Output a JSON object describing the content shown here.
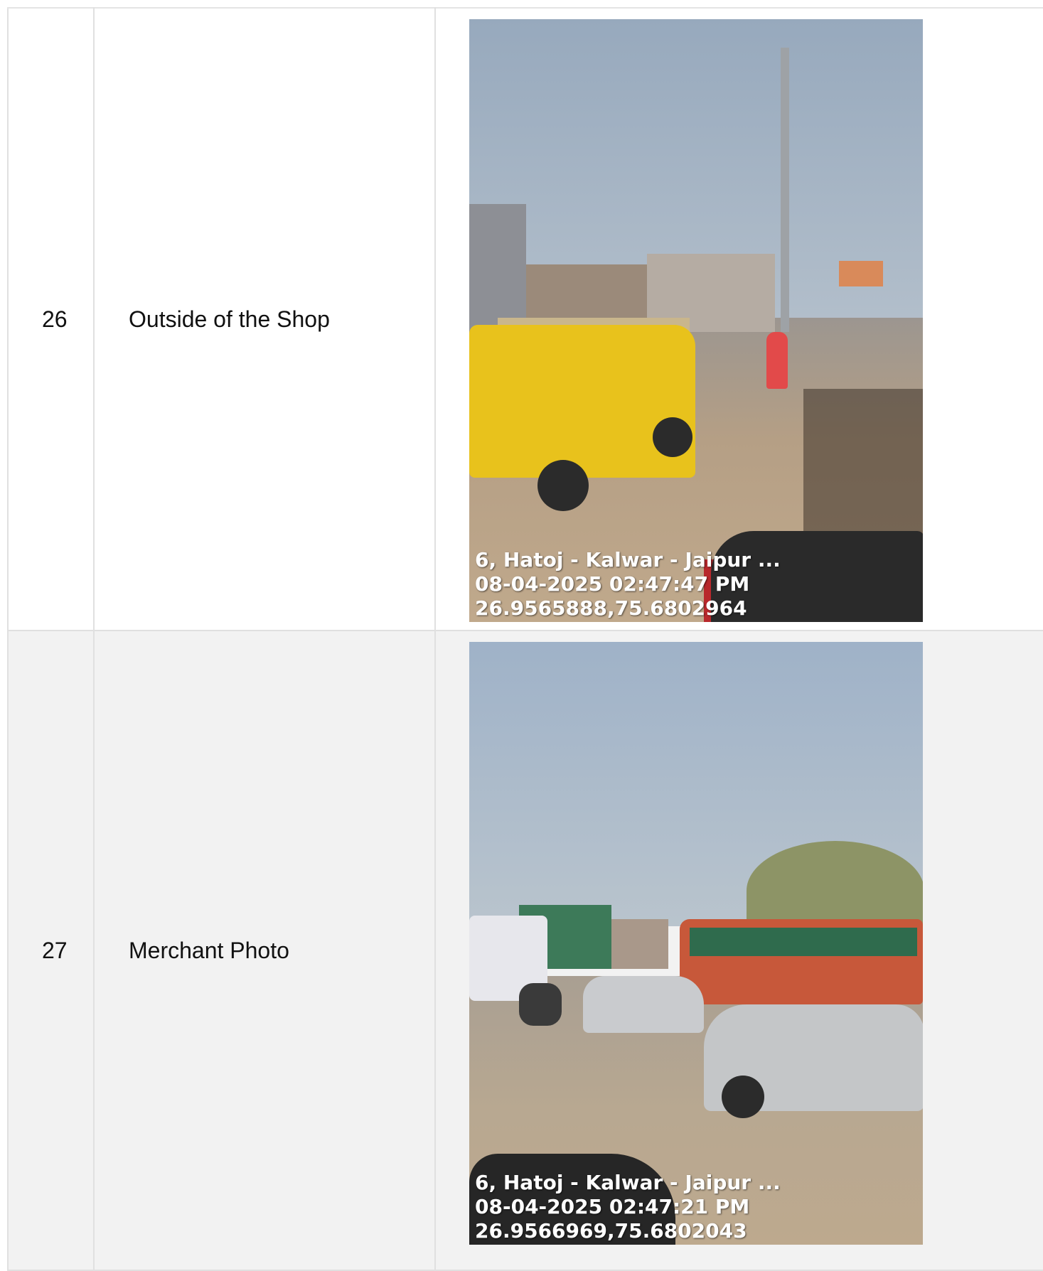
{
  "rows": [
    {
      "number": "26",
      "label": "Outside of the Shop",
      "photo": {
        "stamp_line1": "6, Hatoj - Kalwar - Jaipur ...",
        "stamp_line2": "08-04-2025 02:47:47 PM",
        "stamp_line3": "26.9565888,75.6802964"
      }
    },
    {
      "number": "27",
      "label": "Merchant Photo",
      "photo": {
        "stamp_line1": "6, Hatoj - Kalwar - Jaipur ...",
        "stamp_line2": "08-04-2025 02:47:21 PM",
        "stamp_line3": "26.9566969,75.6802043"
      }
    }
  ],
  "colors": {
    "table_border": "#e0e0e0",
    "row_alt_bg": "#f2f2f2",
    "text": "#111111"
  }
}
